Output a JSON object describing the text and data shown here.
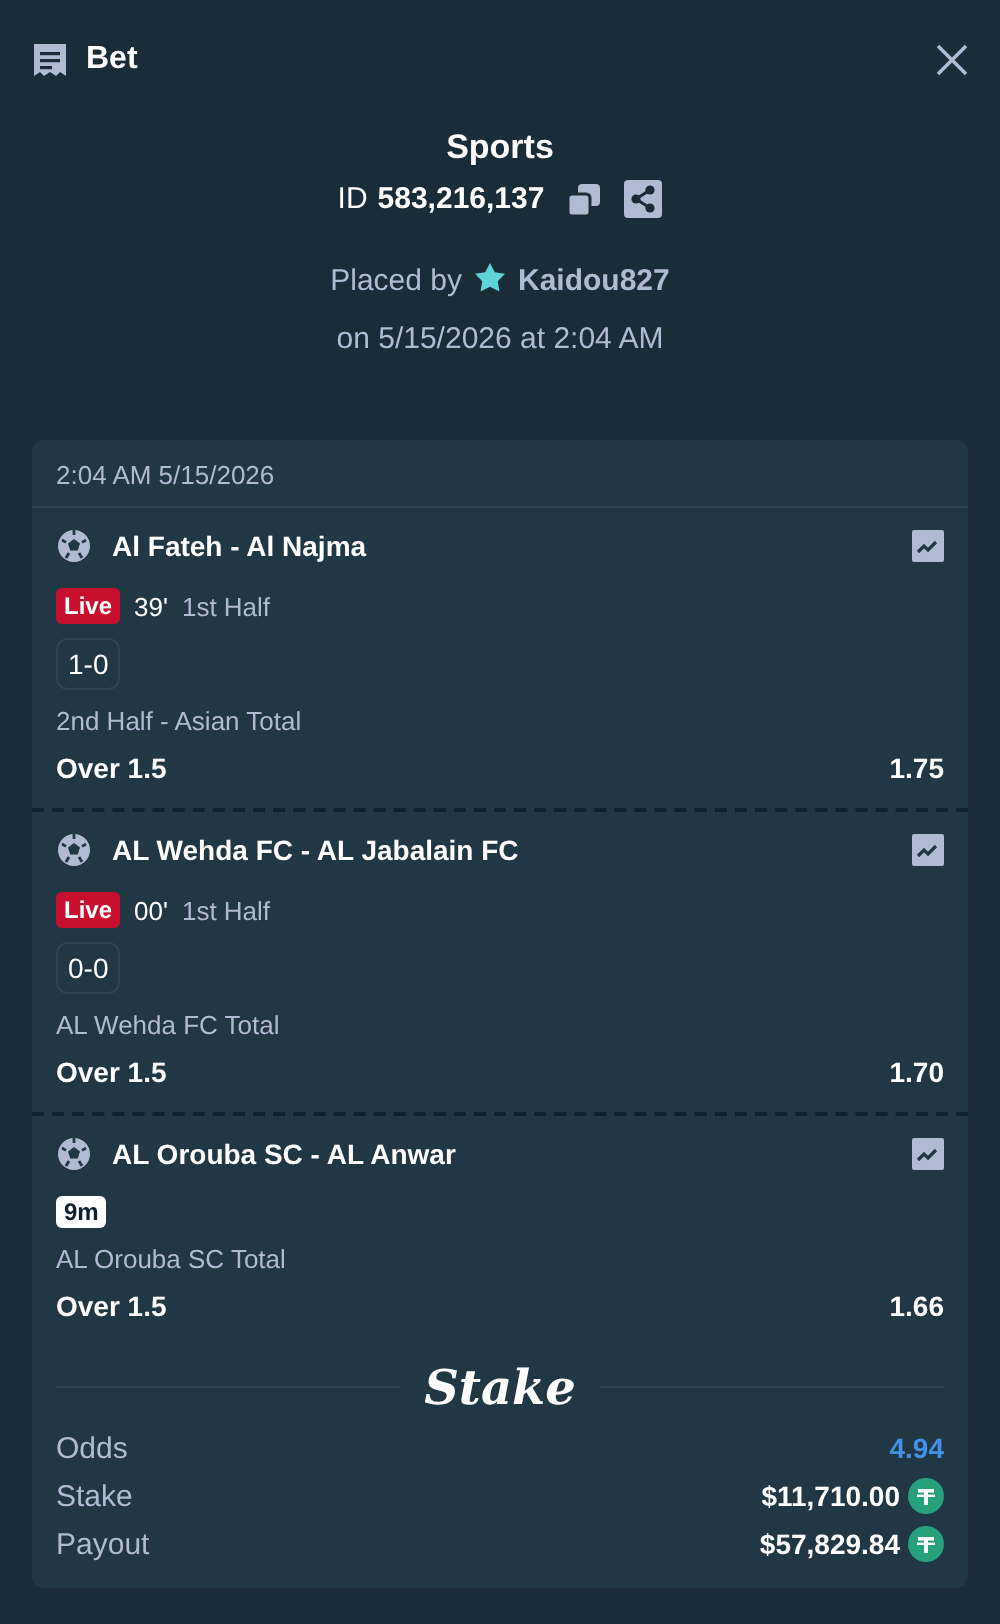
{
  "header": {
    "title": "Bet"
  },
  "summary": {
    "category": "Sports",
    "id_label": "ID",
    "id_value": "583,216,137",
    "placed_by_label": "Placed by",
    "user": "Kaidou827",
    "placed_on": "on 5/15/2026 at 2:04 AM"
  },
  "card": {
    "timestamp": "2:04 AM 5/15/2026",
    "legs": [
      {
        "match": "Al Fateh - Al Najma",
        "kind": "live",
        "badge": "Live",
        "minute": "39'",
        "period": "1st Half",
        "score": "1-0",
        "market": "2nd Half - Asian Total",
        "outcome": "Over 1.5",
        "odds": "1.75"
      },
      {
        "match": "AL Wehda FC - AL Jabalain FC",
        "kind": "live",
        "badge": "Live",
        "minute": "00'",
        "period": "1st Half",
        "score": "0-0",
        "market": "AL Wehda FC Total",
        "outcome": "Over 1.5",
        "odds": "1.70"
      },
      {
        "match": "AL Orouba SC - AL Anwar",
        "kind": "upcoming",
        "badge": "9m",
        "market": "AL Orouba SC Total",
        "outcome": "Over 1.5",
        "odds": "1.66"
      }
    ],
    "brand": "Stake",
    "totals": [
      {
        "label": "Odds",
        "value": "4.94",
        "kind": "odds"
      },
      {
        "label": "Stake",
        "value": "$11,710.00",
        "kind": "amount"
      },
      {
        "label": "Payout",
        "value": "$57,829.84",
        "kind": "amount"
      }
    ]
  }
}
